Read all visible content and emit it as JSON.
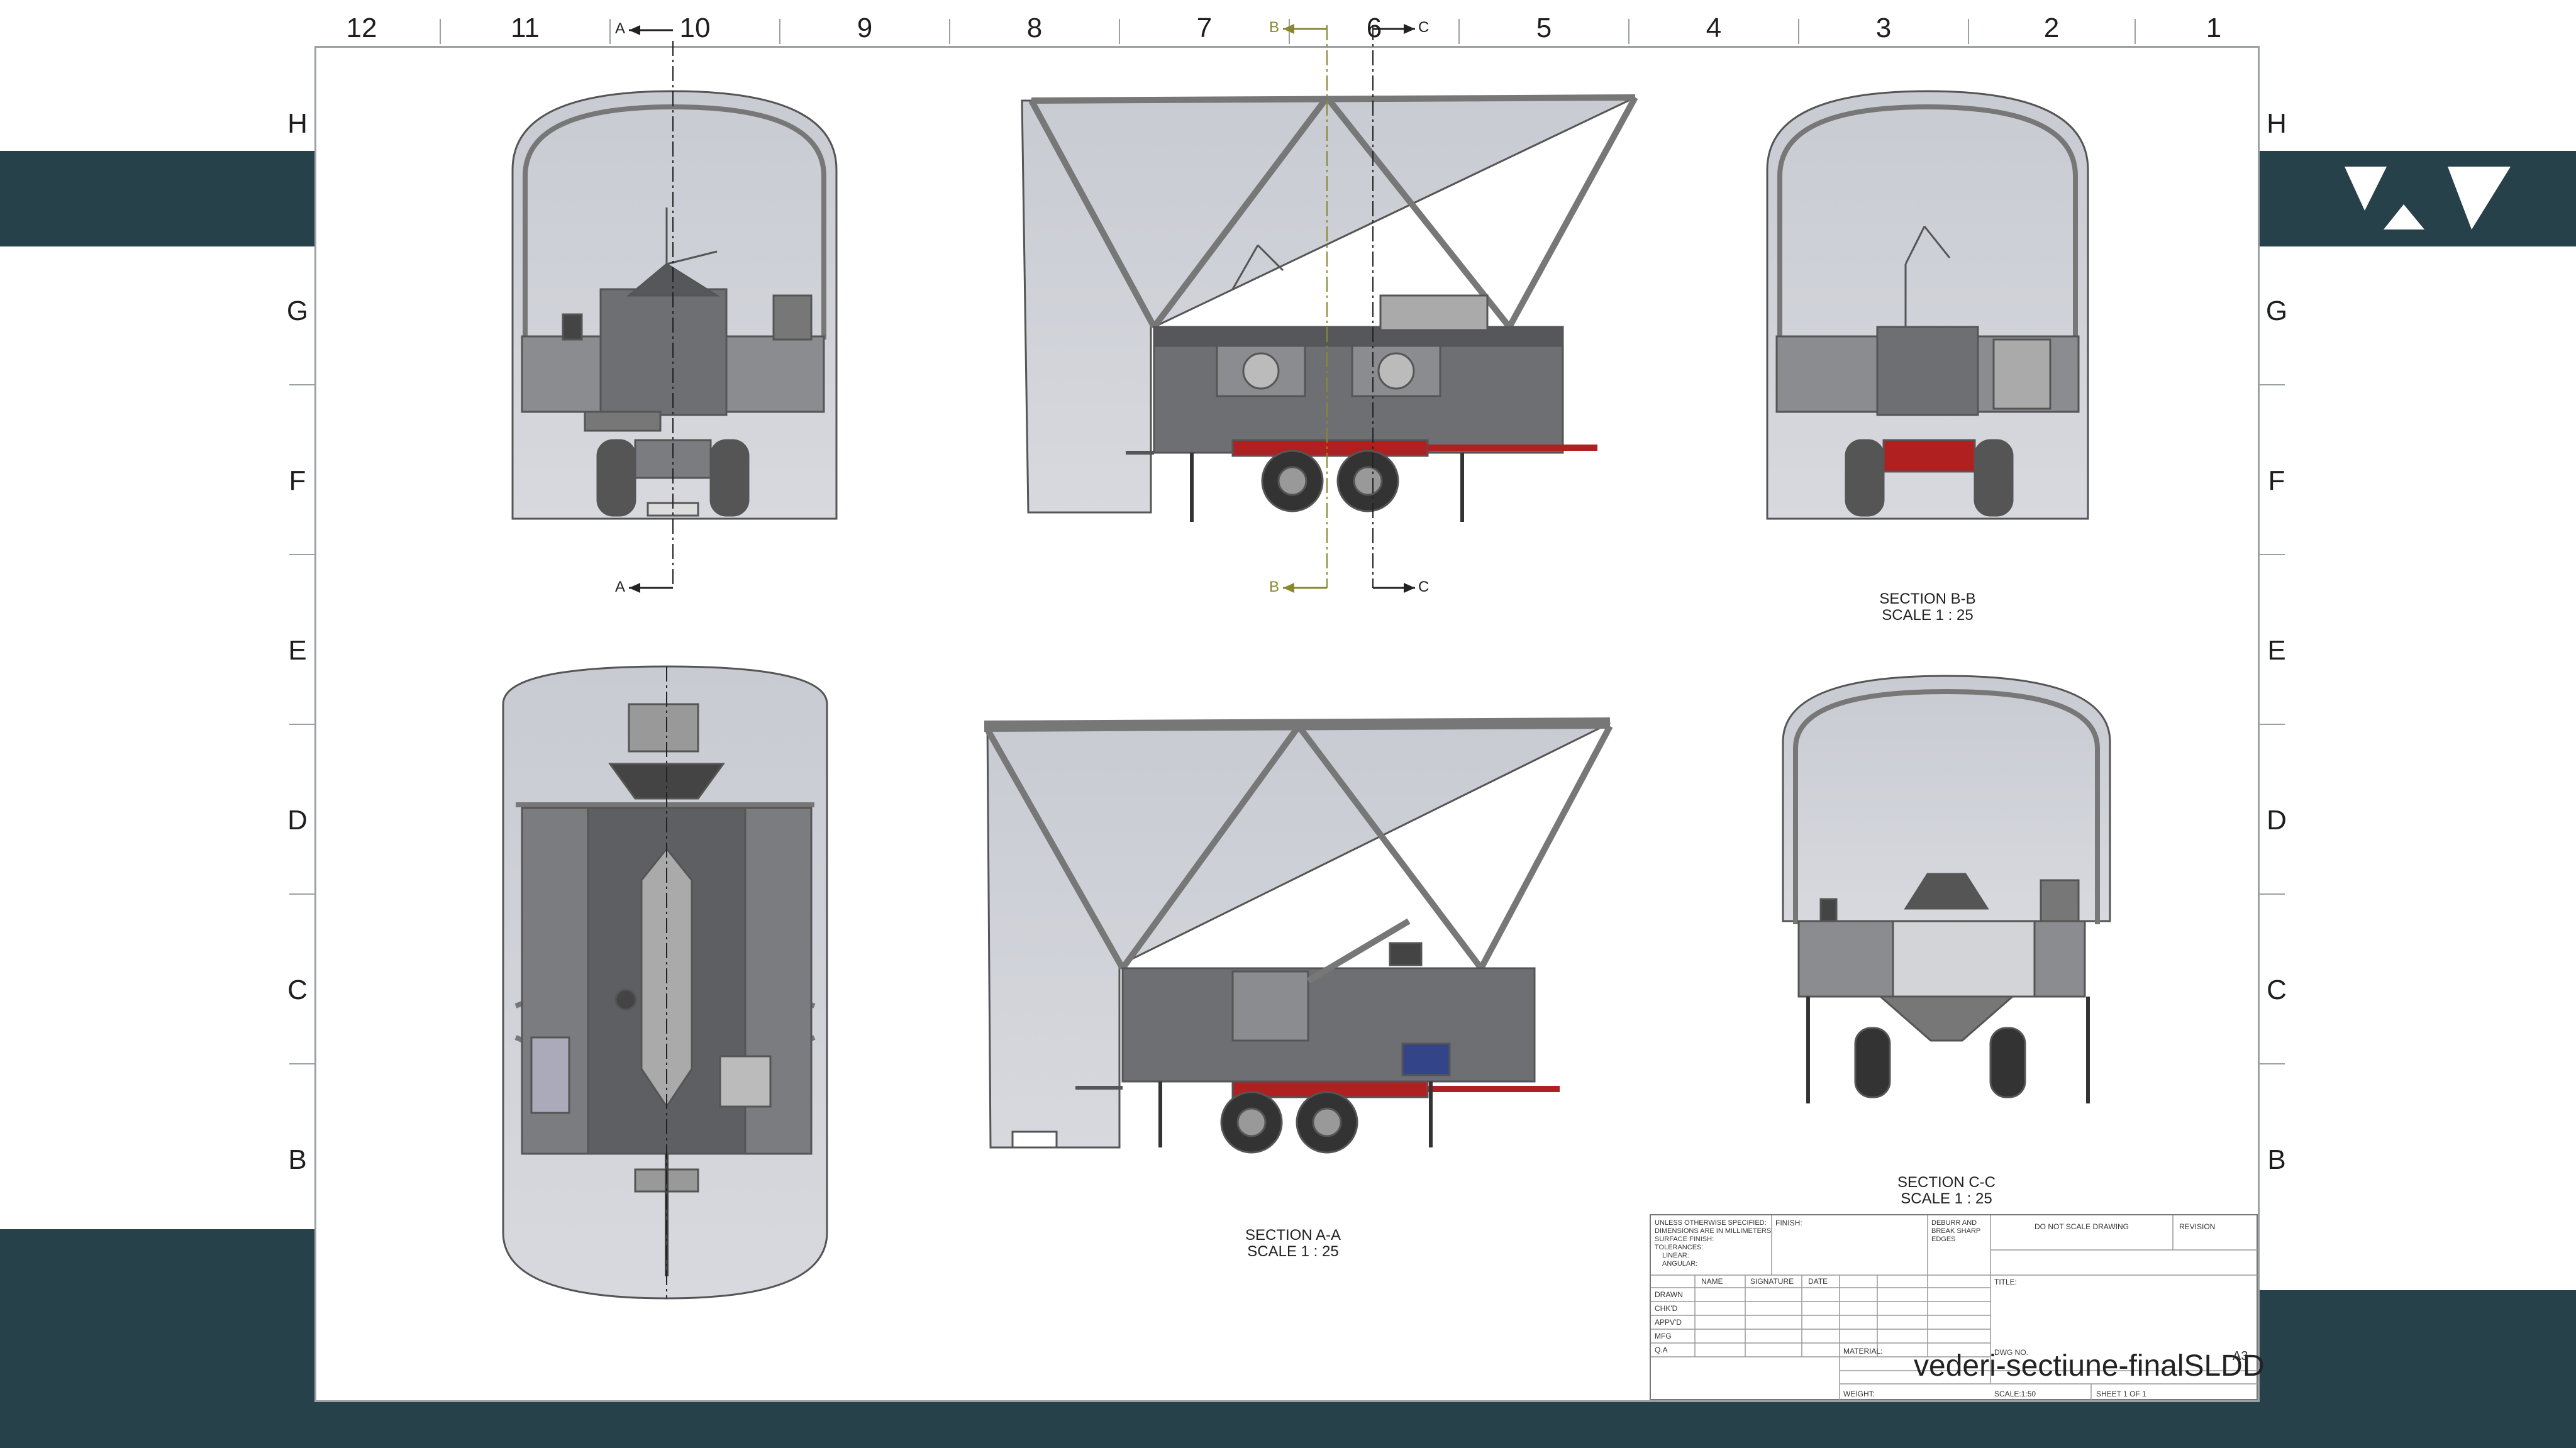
{
  "brand": {
    "band_color": "#27414a",
    "logo_icon": "wv-logo-icon"
  },
  "zones": {
    "columns": [
      "12",
      "11",
      "10",
      "9",
      "8",
      "7",
      "6",
      "5",
      "4",
      "3",
      "2",
      "1"
    ],
    "rows": [
      "H",
      "G",
      "F",
      "E",
      "D",
      "C",
      "B"
    ]
  },
  "section_markers": {
    "a": "A",
    "b": "B",
    "c": "C"
  },
  "captions": {
    "section_aa": {
      "title": "SECTION A-A",
      "scale": "SCALE 1 : 25"
    },
    "section_bb": {
      "title": "SECTION B-B",
      "scale": "SCALE 1 : 25"
    },
    "section_cc": {
      "title": "SECTION C-C",
      "scale": "SCALE 1 : 25"
    }
  },
  "title_block": {
    "notes": [
      "UNLESS OTHERWISE SPECIFIED:",
      "DIMENSIONS ARE IN MILLIMETERS",
      "SURFACE FINISH:",
      "TOLERANCES:",
      "LINEAR:",
      "ANGULAR:"
    ],
    "finish": "FINISH:",
    "deburr": [
      "DEBURR AND",
      "BREAK SHARP",
      "EDGES"
    ],
    "do_not_scale": "DO NOT SCALE DRAWING",
    "revision": "REVISION",
    "columns": [
      "NAME",
      "SIGNATURE",
      "DATE"
    ],
    "roles": [
      "DRAWN",
      "CHK'D",
      "APPV'D",
      "MFG",
      "Q.A"
    ],
    "title_label": "TITLE:",
    "material": "MATERIAL:",
    "dwg_no": "DWG NO.",
    "weight": "WEIGHT:",
    "scale": "SCALE:1:50",
    "sheet": "SHEET 1 OF 1",
    "drawing_name": "vederi-sectiune-finalSLDD",
    "size": "A3"
  }
}
